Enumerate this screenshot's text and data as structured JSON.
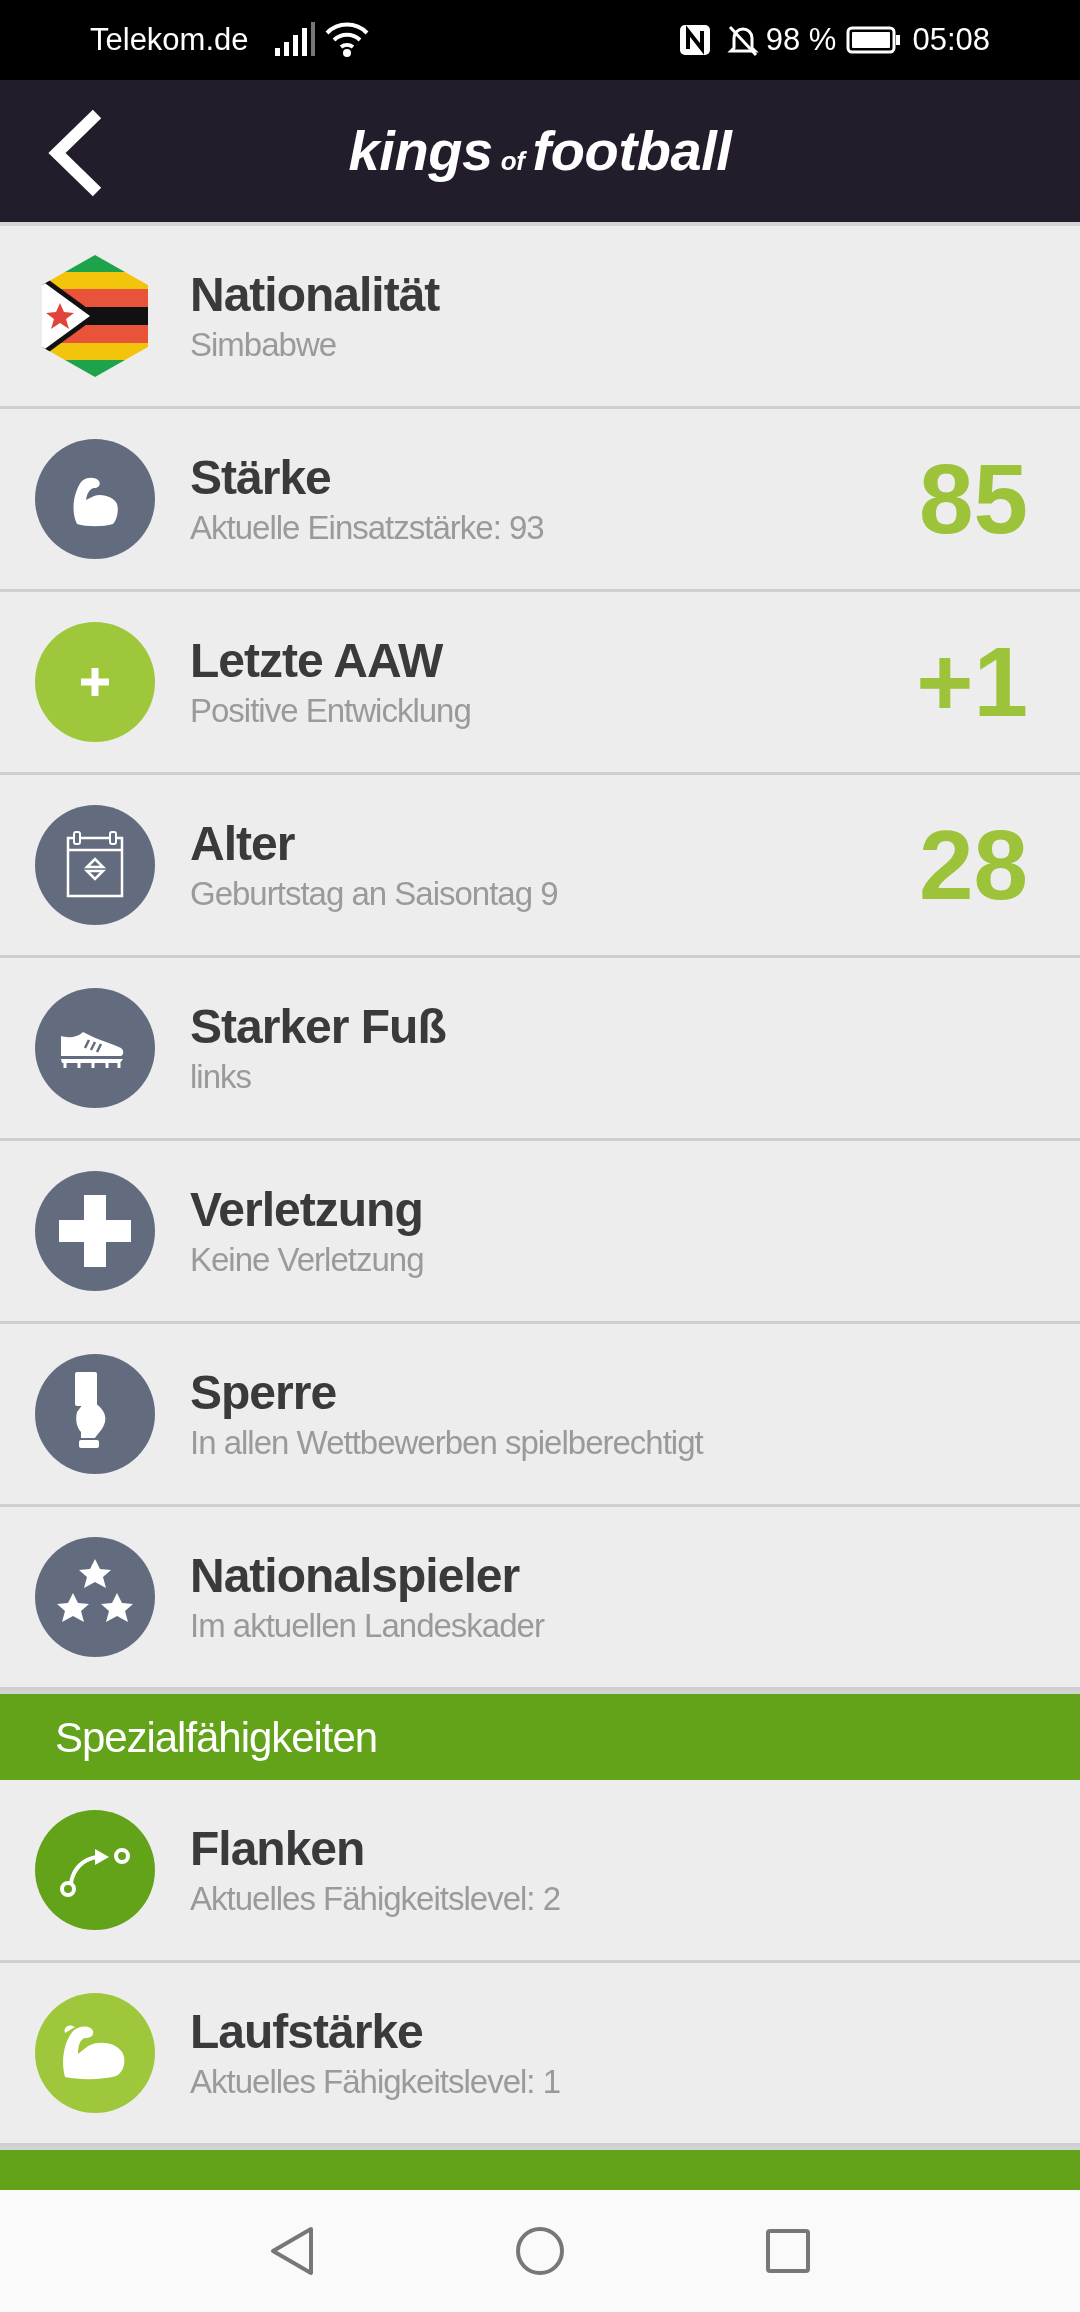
{
  "status_bar": {
    "carrier": "Telekom.de",
    "battery": "98 %",
    "time": "05:08"
  },
  "header": {
    "logo": {
      "word_1": "kings",
      "word_2": "of",
      "word_3": "football"
    }
  },
  "sections": [
    {
      "rows": [
        {
          "title": "Nationalität",
          "subtitle": "Simbabwe"
        },
        {
          "title": "Stärke",
          "subtitle": "Aktuelle Einsatzstärke: 93",
          "value": "85"
        },
        {
          "title": "Letzte AAW",
          "subtitle": "Positive Entwicklung",
          "value": "+1"
        },
        {
          "title": "Alter",
          "subtitle": "Geburtstag an Saisontag 9",
          "value": "28"
        },
        {
          "title": "Starker Fuß",
          "subtitle": "links"
        },
        {
          "title": "Verletzung",
          "subtitle": "Keine Verletzung"
        },
        {
          "title": "Sperre",
          "subtitle": "In allen Wettbewerben spielberechtigt"
        },
        {
          "title": "Nationalspieler",
          "subtitle": "Im aktuellen Landeskader"
        }
      ]
    },
    {
      "header": "Spezialfähigkeiten",
      "rows": [
        {
          "title": "Flanken",
          "subtitle": "Aktuelles Fähigkeitslevel: 2"
        },
        {
          "title": "Laufstärke",
          "subtitle": "Aktuelles Fähigkeitslevel: 1"
        }
      ]
    }
  ]
}
